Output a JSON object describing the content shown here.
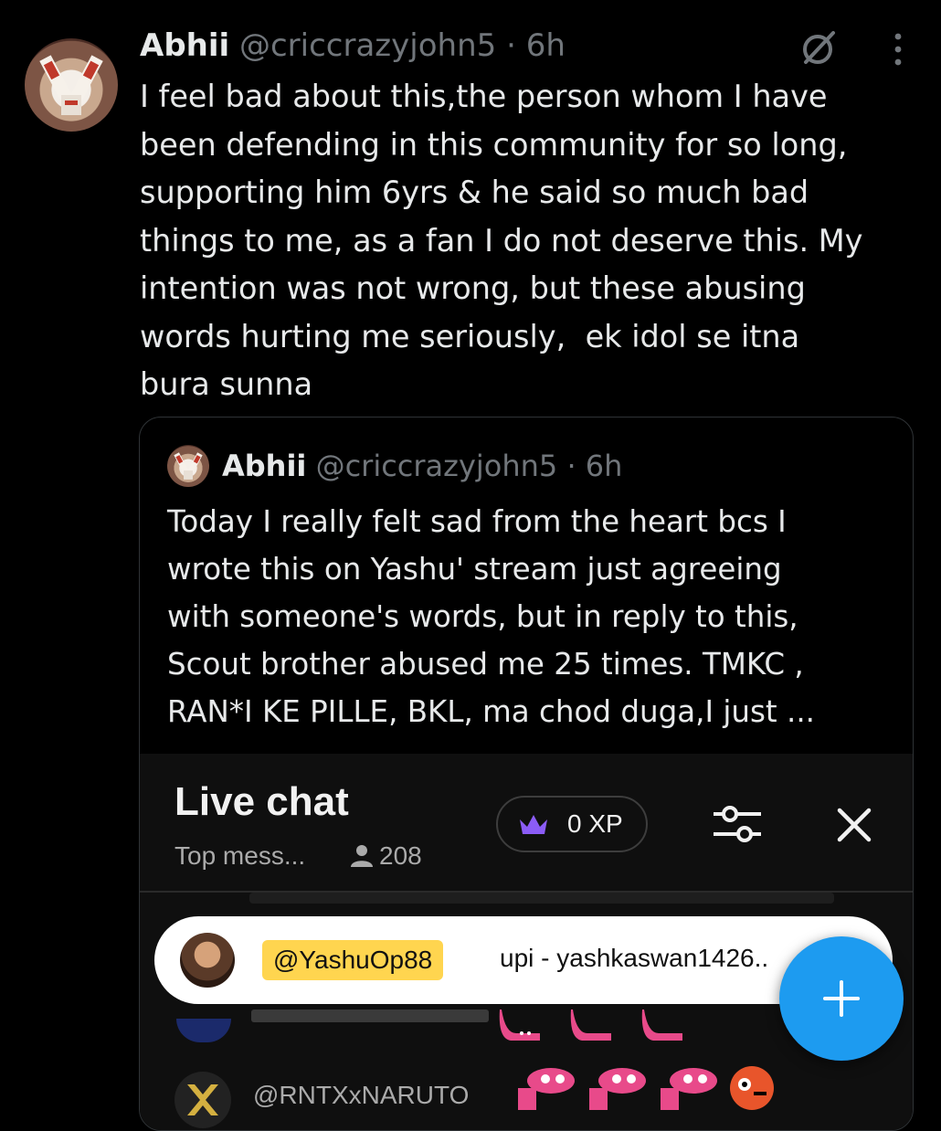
{
  "tweet": {
    "author_name": "Abhii",
    "handle": "@criccrazyjohn5",
    "separator": "·",
    "time": "6h",
    "text": "I feel bad about this,the person whom I have\nbeen defending in this community for so long,\nsupporting him 6yrs & he said so much bad\nthings to me, as a fan I do not deserve this. My\nintention was not wrong, but these abusing\nwords hurting me seriously,  ek idol se itna\nbura sunna"
  },
  "icons": {
    "grok": "grok-icon",
    "more": "more-vertical-icon",
    "viewers": "person-icon",
    "crown": "crown-icon",
    "tune": "tune-icon",
    "close": "close-icon",
    "fab": "plus-icon"
  },
  "quoted": {
    "author_name": "Abhii",
    "handle": "@criccrazyjohn5",
    "separator": "·",
    "time": "6h",
    "text": "Today I really felt sad from the heart bcs I\nwrote this on Yashu' stream just agreeing\nwith someone's words, but in reply to this,\nScout brother abused me 25 times. TMKC ,\nRAN*I KE PILLE, BKL, ma chod duga,I just ...",
    "live_chat": {
      "title": "Live chat",
      "filter": "Top mess...",
      "viewers": "208",
      "xp": "0 XP",
      "pinned_user": "@YashuOp88",
      "pinned_message": "upi - yashkaswan1426..",
      "last_user": "@RNTXxNARUTO"
    }
  },
  "colors": {
    "background": "#000000",
    "text": "#e7e9ea",
    "muted": "#71767b",
    "accent": "#1d9bf0",
    "chat_bg": "#0f0f0f",
    "badge": "#ffd54f"
  }
}
